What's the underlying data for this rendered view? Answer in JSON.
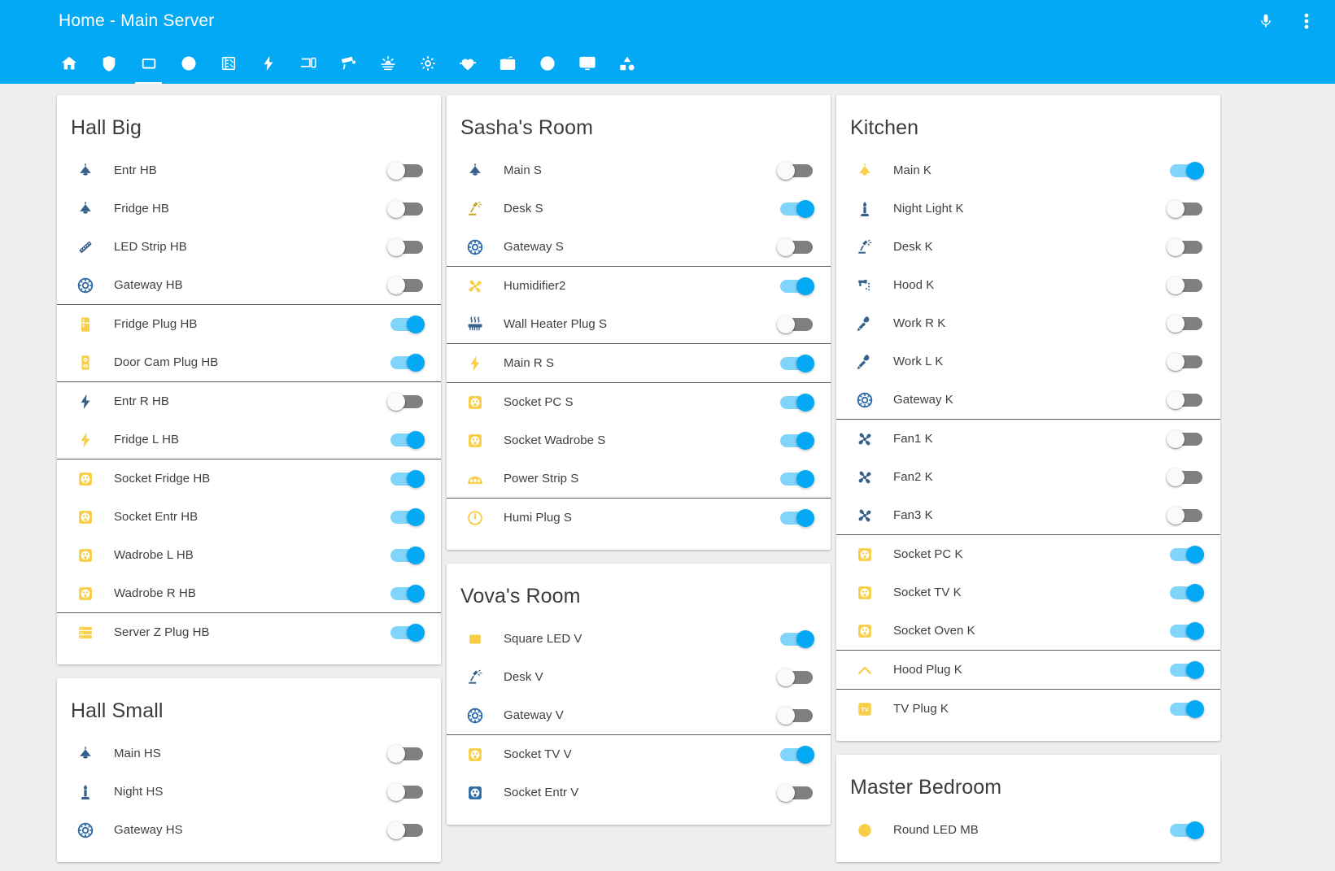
{
  "app": {
    "title": "Home - Main Server",
    "actions": [
      {
        "name": "microphone-icon",
        "label": "Voice assistant"
      },
      {
        "name": "overflow-menu-icon",
        "label": "More options"
      }
    ],
    "tabs": [
      {
        "id": "home",
        "icon": "home-icon",
        "label": "Home",
        "active": false
      },
      {
        "id": "security",
        "icon": "shield-icon",
        "label": "Security",
        "active": false
      },
      {
        "id": "lights",
        "icon": "square-icon",
        "label": "Lights",
        "active": true
      },
      {
        "id": "vacuum",
        "icon": "disc-icon",
        "label": "Vacuum",
        "active": false
      },
      {
        "id": "meters",
        "icon": "meter-icon",
        "label": "Meters",
        "active": false
      },
      {
        "id": "power",
        "icon": "lightning-icon",
        "label": "Power",
        "active": false
      },
      {
        "id": "devices",
        "icon": "devices-icon",
        "label": "Devices",
        "active": false
      },
      {
        "id": "cameras",
        "icon": "cctv-icon",
        "label": "Cameras",
        "active": false
      },
      {
        "id": "weather",
        "icon": "sunset-icon",
        "label": "Weather",
        "active": false
      },
      {
        "id": "settings",
        "icon": "gear-icon",
        "label": "Settings",
        "active": false
      },
      {
        "id": "health",
        "icon": "heartbeat-icon",
        "label": "Health",
        "active": false
      },
      {
        "id": "radio",
        "icon": "radio-icon",
        "label": "Radio",
        "active": false
      },
      {
        "id": "globe",
        "icon": "globe-icon",
        "label": "Network",
        "active": false
      },
      {
        "id": "dashboard",
        "icon": "dashboard-icon",
        "label": "Dashboard",
        "active": false
      },
      {
        "id": "shapes",
        "icon": "shapes-icon",
        "label": "Scenes",
        "active": false
      }
    ]
  },
  "columns": [
    {
      "id": "col-1",
      "cards": [
        {
          "title": "Hall Big",
          "groups": [
            {
              "rows": [
                {
                  "label": "Entr HB",
                  "icon": "ceiling-light-icon",
                  "icon_color": "#37618a",
                  "on": false
                },
                {
                  "label": "Fridge HB",
                  "icon": "ceiling-light-icon",
                  "icon_color": "#37618a",
                  "on": false
                },
                {
                  "label": "LED Strip HB",
                  "icon": "led-strip-icon",
                  "icon_color": "#37618a",
                  "on": false
                },
                {
                  "label": "Gateway HB",
                  "icon": "gateway-icon",
                  "icon_color": "#2f6ba6",
                  "on": false
                }
              ]
            },
            {
              "rows": [
                {
                  "label": "Fridge Plug HB",
                  "icon": "fridge-icon",
                  "icon_color": "#f7ce46",
                  "on": true
                },
                {
                  "label": "Door Cam Plug HB",
                  "icon": "doorbell-icon",
                  "icon_color": "#f7ce46",
                  "on": true
                }
              ]
            },
            {
              "rows": [
                {
                  "label": "Entr R HB",
                  "icon": "lightning-icon",
                  "icon_color": "#37618a",
                  "on": false
                },
                {
                  "label": "Fridge L HB",
                  "icon": "lightning-icon",
                  "icon_color": "#f7ce46",
                  "on": true
                }
              ]
            },
            {
              "rows": [
                {
                  "label": "Socket Fridge HB",
                  "icon": "socket-icon",
                  "icon_color": "#f7ce46",
                  "on": true
                },
                {
                  "label": "Socket Entr HB",
                  "icon": "socket-icon",
                  "icon_color": "#f7ce46",
                  "on": true
                },
                {
                  "label": "Wadrobe L HB",
                  "icon": "socket-icon",
                  "icon_color": "#f7ce46",
                  "on": true
                },
                {
                  "label": "Wadrobe R HB",
                  "icon": "socket-icon",
                  "icon_color": "#f7ce46",
                  "on": true
                }
              ]
            },
            {
              "rows": [
                {
                  "label": "Server Z Plug HB",
                  "icon": "server-icon",
                  "icon_color": "#f7ce46",
                  "on": true
                }
              ]
            }
          ]
        },
        {
          "title": "Hall Small",
          "groups": [
            {
              "rows": [
                {
                  "label": "Main HS",
                  "icon": "ceiling-light-icon",
                  "icon_color": "#37618a",
                  "on": false
                },
                {
                  "label": "Night HS",
                  "icon": "candle-icon",
                  "icon_color": "#37618a",
                  "on": false
                },
                {
                  "label": "Gateway HS",
                  "icon": "gateway-icon",
                  "icon_color": "#2f6ba6",
                  "on": false
                }
              ]
            }
          ]
        }
      ]
    },
    {
      "id": "col-2",
      "cards": [
        {
          "title": "Sasha's Room",
          "groups": [
            {
              "rows": [
                {
                  "label": "Main S",
                  "icon": "ceiling-light-icon",
                  "icon_color": "#37618a",
                  "on": false
                },
                {
                  "label": "Desk S",
                  "icon": "desk-lamp-icon",
                  "icon_color": "#c6a41e",
                  "on": true
                },
                {
                  "label": "Gateway S",
                  "icon": "gateway-icon",
                  "icon_color": "#2f6ba6",
                  "on": false
                }
              ]
            },
            {
              "rows": [
                {
                  "label": "Humidifier2",
                  "icon": "fan-icon",
                  "icon_color": "#f7ce46",
                  "on": true
                },
                {
                  "label": "Wall Heater Plug S",
                  "icon": "heater-icon",
                  "icon_color": "#37618a",
                  "on": false
                }
              ]
            },
            {
              "rows": [
                {
                  "label": "Main R S",
                  "icon": "lightning-icon",
                  "icon_color": "#f7ce46",
                  "on": true
                }
              ]
            },
            {
              "rows": [
                {
                  "label": "Socket PC S",
                  "icon": "socket-icon",
                  "icon_color": "#f7ce46",
                  "on": true
                },
                {
                  "label": "Socket Wadrobe S",
                  "icon": "socket-icon",
                  "icon_color": "#f7ce46",
                  "on": true
                },
                {
                  "label": "Power Strip S",
                  "icon": "power-strip-icon",
                  "icon_color": "#f7ce46",
                  "on": true
                }
              ]
            },
            {
              "rows": [
                {
                  "label": "Humi Plug S",
                  "icon": "power-button-icon",
                  "icon_color": "#f7ce46",
                  "on": true
                }
              ]
            }
          ]
        },
        {
          "title": "Vova's Room",
          "groups": [
            {
              "rows": [
                {
                  "label": "Square LED V",
                  "icon": "square-led-icon",
                  "icon_color": "#f7ce46",
                  "on": true
                },
                {
                  "label": "Desk V",
                  "icon": "desk-lamp-icon",
                  "icon_color": "#37618a",
                  "on": false
                },
                {
                  "label": "Gateway V",
                  "icon": "gateway-icon",
                  "icon_color": "#2f6ba6",
                  "on": false
                }
              ]
            },
            {
              "rows": [
                {
                  "label": "Socket TV V",
                  "icon": "socket-icon",
                  "icon_color": "#f7ce46",
                  "on": true
                },
                {
                  "label": "Socket Entr V",
                  "icon": "socket-icon",
                  "icon_color": "#2f6ba6",
                  "on": false
                }
              ]
            }
          ]
        }
      ]
    },
    {
      "id": "col-3",
      "cards": [
        {
          "title": "Kitchen",
          "groups": [
            {
              "rows": [
                {
                  "label": "Main K",
                  "icon": "ceiling-light-icon",
                  "icon_color": "#f7ce46",
                  "on": true
                },
                {
                  "label": "Night Light K",
                  "icon": "candle-icon",
                  "icon_color": "#37618a",
                  "on": false
                },
                {
                  "label": "Desk K",
                  "icon": "desk-lamp-icon",
                  "icon_color": "#37618a",
                  "on": false
                },
                {
                  "label": "Hood K",
                  "icon": "hood-light-icon",
                  "icon_color": "#37618a",
                  "on": false
                },
                {
                  "label": "Work R K",
                  "icon": "spotlight-icon",
                  "icon_color": "#37618a",
                  "on": false
                },
                {
                  "label": "Work L K",
                  "icon": "spotlight-icon",
                  "icon_color": "#37618a",
                  "on": false
                },
                {
                  "label": "Gateway K",
                  "icon": "gateway-icon",
                  "icon_color": "#2f6ba6",
                  "on": false
                }
              ]
            },
            {
              "rows": [
                {
                  "label": "Fan1 K",
                  "icon": "fan-icon",
                  "icon_color": "#37618a",
                  "on": false
                },
                {
                  "label": "Fan2 K",
                  "icon": "fan-icon",
                  "icon_color": "#37618a",
                  "on": false
                },
                {
                  "label": "Fan3 K",
                  "icon": "fan-icon",
                  "icon_color": "#37618a",
                  "on": false
                }
              ]
            },
            {
              "rows": [
                {
                  "label": "Socket PC K",
                  "icon": "socket-icon",
                  "icon_color": "#f7ce46",
                  "on": true
                },
                {
                  "label": "Socket TV K",
                  "icon": "socket-icon",
                  "icon_color": "#f7ce46",
                  "on": true
                },
                {
                  "label": "Socket Oven K",
                  "icon": "socket-icon",
                  "icon_color": "#f7ce46",
                  "on": true
                }
              ]
            },
            {
              "rows": [
                {
                  "label": "Hood Plug K",
                  "icon": "chevron-up-icon",
                  "icon_color": "#f7ce46",
                  "on": true
                }
              ]
            },
            {
              "rows": [
                {
                  "label": "TV Plug K",
                  "icon": "tv-icon",
                  "icon_color": "#f7ce46",
                  "on": true
                }
              ]
            }
          ]
        },
        {
          "title": "Master Bedroom",
          "groups": [
            {
              "rows": [
                {
                  "label": "Round LED MB",
                  "icon": "round-led-icon",
                  "icon_color": "#f7ce46",
                  "on": true
                }
              ]
            }
          ]
        }
      ]
    }
  ],
  "colors": {
    "accent": "#03a9f4",
    "toggle_on_track": "#81d4fa",
    "toggle_off_track": "#808080",
    "card_bg": "#ffffff",
    "page_bg": "#eeeeee",
    "icon_on": "#f7ce46",
    "icon_off": "#37618a"
  }
}
